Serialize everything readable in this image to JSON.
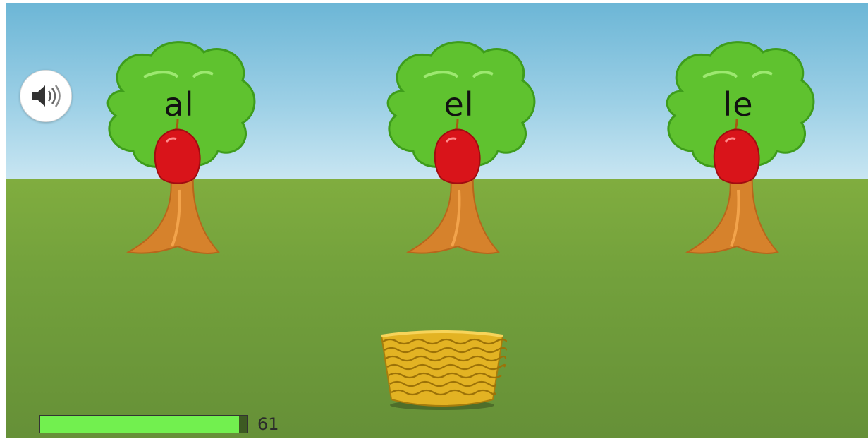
{
  "sound_button": {
    "icon": "speaker-icon"
  },
  "trees": [
    {
      "word": "al"
    },
    {
      "word": "el"
    },
    {
      "word": "le"
    }
  ],
  "basket": {
    "icon": "basket-icon"
  },
  "timer": {
    "value": "61",
    "fraction_remaining": 0.96
  },
  "colors": {
    "sky": "#6cb6d6",
    "grass": "#73a13c",
    "foliage": "#5fc22f",
    "apple": "#d9141a",
    "trunk": "#d6822c",
    "basket": "#e3b323",
    "progress": "#72f04f"
  }
}
